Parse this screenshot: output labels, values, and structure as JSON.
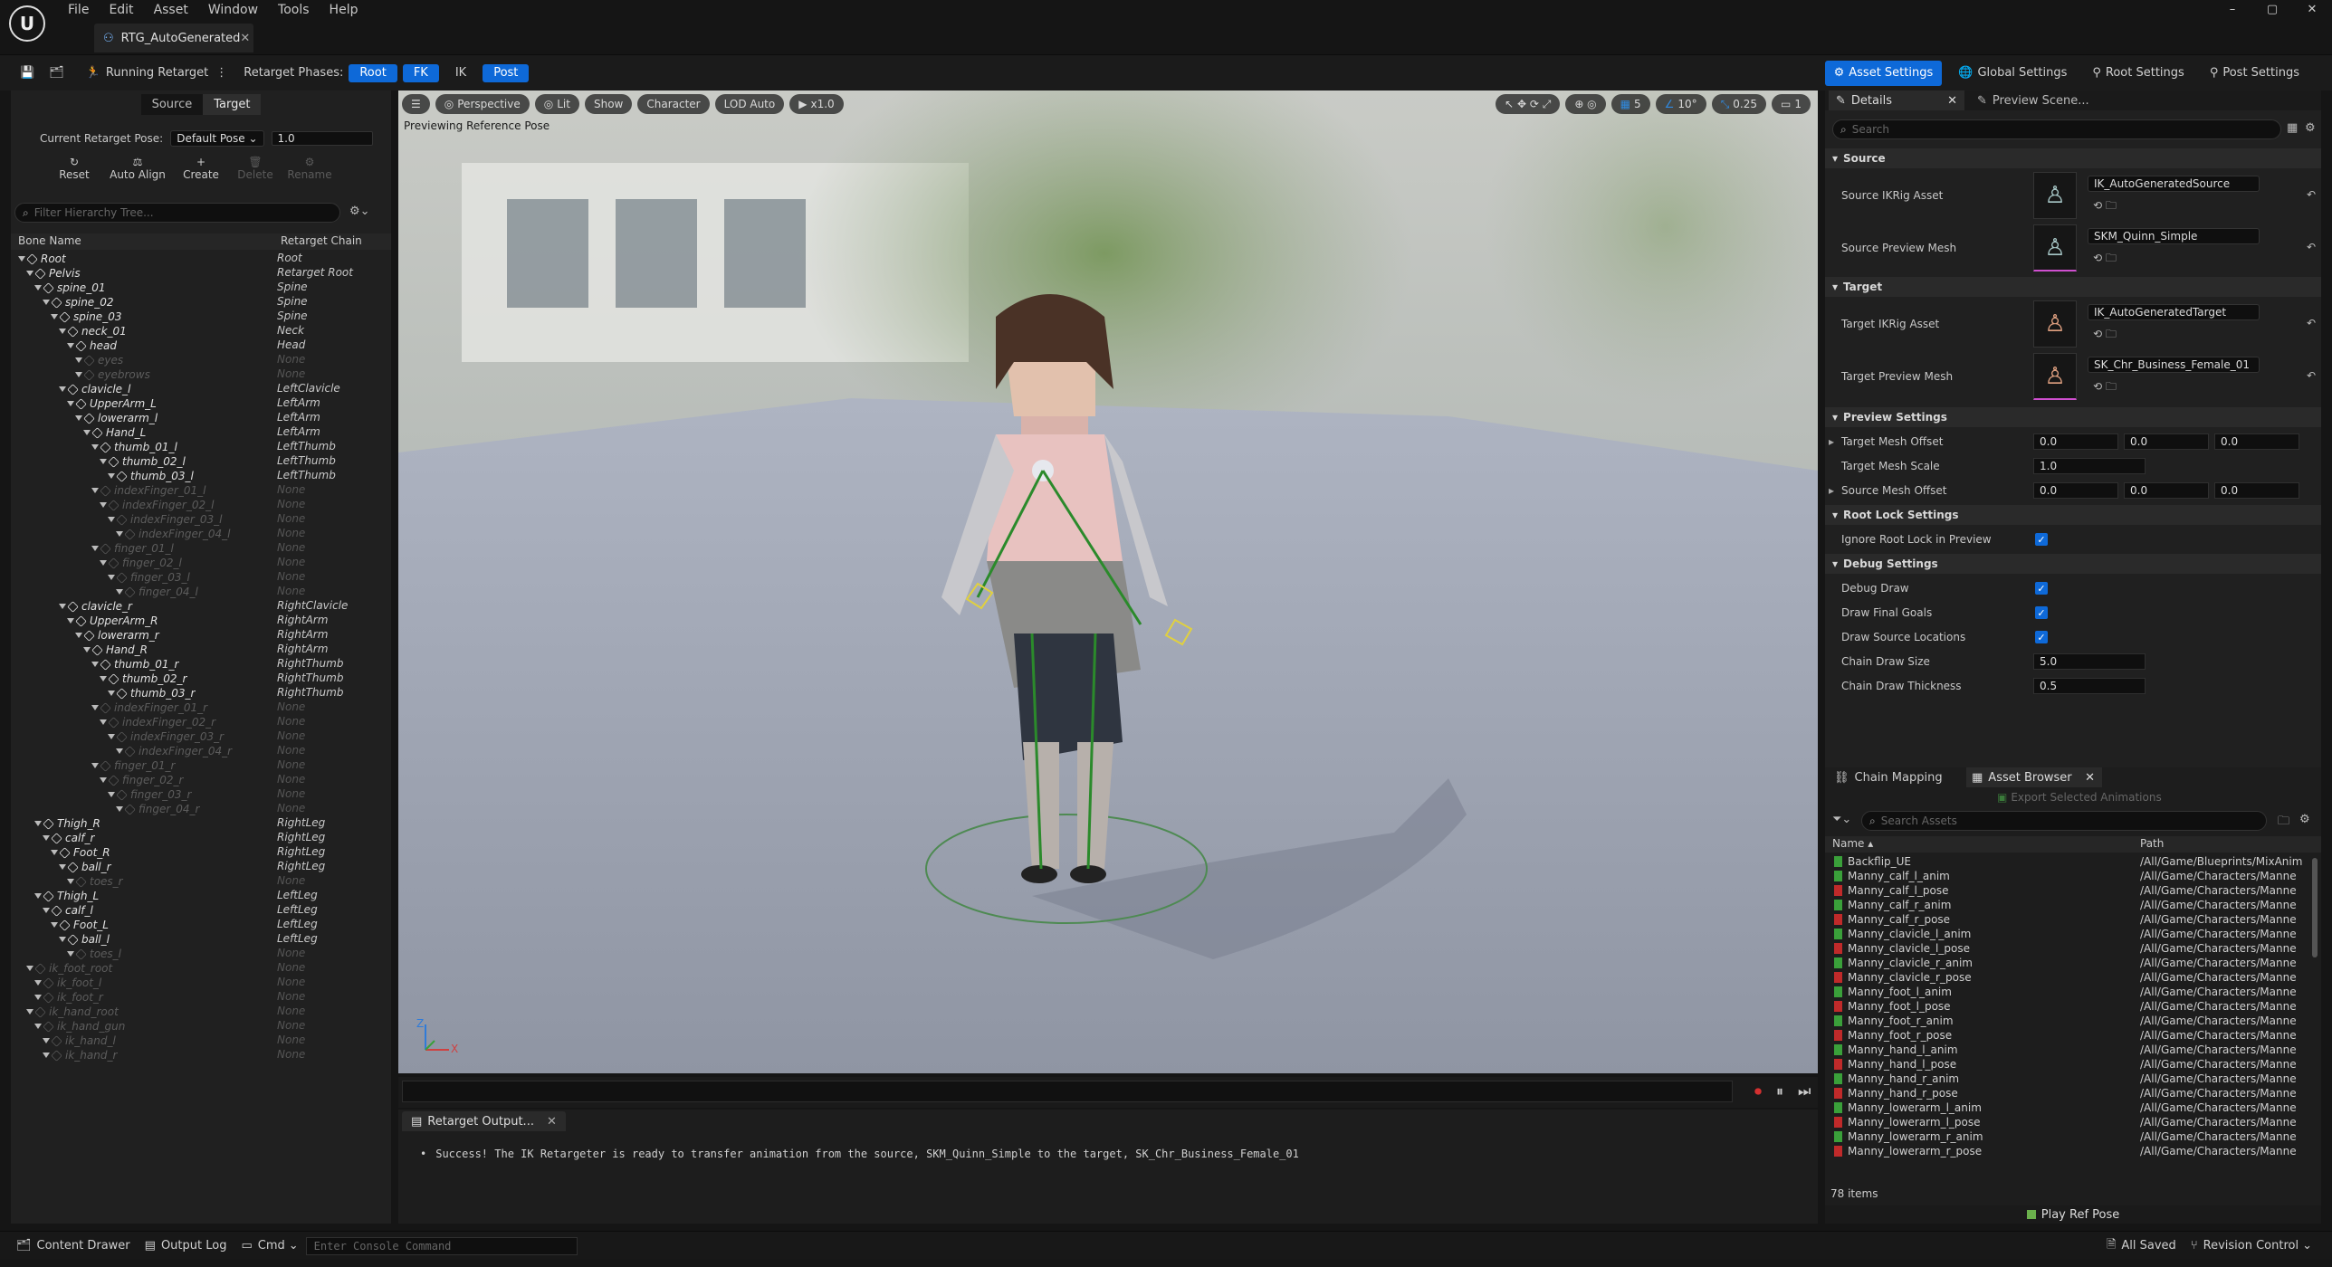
{
  "app": {
    "title": "RTG_AutoGenerated"
  },
  "menu": [
    "File",
    "Edit",
    "Asset",
    "Window",
    "Tools",
    "Help"
  ],
  "window_controls": [
    "–",
    "▢",
    "✕"
  ],
  "toolbar": {
    "running_retarget": "Running Retarget",
    "phases_label": "Retarget Phases:",
    "phases": [
      {
        "label": "Root",
        "on": true
      },
      {
        "label": "FK",
        "on": true
      },
      {
        "label": "IK",
        "on": false
      },
      {
        "label": "Post",
        "on": true
      }
    ],
    "settings_tabs": [
      {
        "label": "Asset Settings",
        "on": true
      },
      {
        "label": "Global Settings",
        "on": false
      },
      {
        "label": "Root Settings",
        "on": false
      },
      {
        "label": "Post Settings",
        "on": false
      }
    ]
  },
  "left": {
    "toggle": {
      "source": "Source",
      "target": "Target"
    },
    "pose_label": "Current Retarget Pose:",
    "pose_value": "Default Pose",
    "pose_blend": "1.0",
    "tools": [
      {
        "label": "Reset",
        "enabled": true
      },
      {
        "label": "Auto Align",
        "enabled": true
      },
      {
        "label": "Create",
        "enabled": true
      },
      {
        "label": "Delete",
        "enabled": false
      },
      {
        "label": "Rename",
        "enabled": false
      }
    ],
    "filter_placeholder": "Filter Hierarchy Tree...",
    "col_bone": "Bone Name",
    "col_chain": "Retarget Chain",
    "bones": [
      {
        "name": "Root",
        "chain": "Root",
        "depth": 0,
        "active": true
      },
      {
        "name": "Pelvis",
        "chain": "Retarget Root",
        "depth": 1,
        "active": true
      },
      {
        "name": "spine_01",
        "chain": "Spine",
        "depth": 2,
        "active": true
      },
      {
        "name": "spine_02",
        "chain": "Spine",
        "depth": 3,
        "active": true
      },
      {
        "name": "spine_03",
        "chain": "Spine",
        "depth": 4,
        "active": true
      },
      {
        "name": "neck_01",
        "chain": "Neck",
        "depth": 5,
        "active": true
      },
      {
        "name": "head",
        "chain": "Head",
        "depth": 6,
        "active": true
      },
      {
        "name": "eyes",
        "chain": "None",
        "depth": 7,
        "active": false
      },
      {
        "name": "eyebrows",
        "chain": "None",
        "depth": 7,
        "active": false
      },
      {
        "name": "clavicle_l",
        "chain": "LeftClavicle",
        "depth": 5,
        "active": true
      },
      {
        "name": "UpperArm_L",
        "chain": "LeftArm",
        "depth": 6,
        "active": true
      },
      {
        "name": "lowerarm_l",
        "chain": "LeftArm",
        "depth": 7,
        "active": true
      },
      {
        "name": "Hand_L",
        "chain": "LeftArm",
        "depth": 8,
        "active": true
      },
      {
        "name": "thumb_01_l",
        "chain": "LeftThumb",
        "depth": 9,
        "active": true
      },
      {
        "name": "thumb_02_l",
        "chain": "LeftThumb",
        "depth": 10,
        "active": true
      },
      {
        "name": "thumb_03_l",
        "chain": "LeftThumb",
        "depth": 11,
        "active": true
      },
      {
        "name": "indexFinger_01_l",
        "chain": "None",
        "depth": 9,
        "active": false
      },
      {
        "name": "indexFinger_02_l",
        "chain": "None",
        "depth": 10,
        "active": false
      },
      {
        "name": "indexFinger_03_l",
        "chain": "None",
        "depth": 11,
        "active": false
      },
      {
        "name": "indexFinger_04_l",
        "chain": "None",
        "depth": 12,
        "active": false
      },
      {
        "name": "finger_01_l",
        "chain": "None",
        "depth": 9,
        "active": false
      },
      {
        "name": "finger_02_l",
        "chain": "None",
        "depth": 10,
        "active": false
      },
      {
        "name": "finger_03_l",
        "chain": "None",
        "depth": 11,
        "active": false
      },
      {
        "name": "finger_04_l",
        "chain": "None",
        "depth": 12,
        "active": false
      },
      {
        "name": "clavicle_r",
        "chain": "RightClavicle",
        "depth": 5,
        "active": true
      },
      {
        "name": "UpperArm_R",
        "chain": "RightArm",
        "depth": 6,
        "active": true
      },
      {
        "name": "lowerarm_r",
        "chain": "RightArm",
        "depth": 7,
        "active": true
      },
      {
        "name": "Hand_R",
        "chain": "RightArm",
        "depth": 8,
        "active": true
      },
      {
        "name": "thumb_01_r",
        "chain": "RightThumb",
        "depth": 9,
        "active": true
      },
      {
        "name": "thumb_02_r",
        "chain": "RightThumb",
        "depth": 10,
        "active": true
      },
      {
        "name": "thumb_03_r",
        "chain": "RightThumb",
        "depth": 11,
        "active": true
      },
      {
        "name": "indexFinger_01_r",
        "chain": "None",
        "depth": 9,
        "active": false
      },
      {
        "name": "indexFinger_02_r",
        "chain": "None",
        "depth": 10,
        "active": false
      },
      {
        "name": "indexFinger_03_r",
        "chain": "None",
        "depth": 11,
        "active": false
      },
      {
        "name": "indexFinger_04_r",
        "chain": "None",
        "depth": 12,
        "active": false
      },
      {
        "name": "finger_01_r",
        "chain": "None",
        "depth": 9,
        "active": false
      },
      {
        "name": "finger_02_r",
        "chain": "None",
        "depth": 10,
        "active": false
      },
      {
        "name": "finger_03_r",
        "chain": "None",
        "depth": 11,
        "active": false
      },
      {
        "name": "finger_04_r",
        "chain": "None",
        "depth": 12,
        "active": false
      },
      {
        "name": "Thigh_R",
        "chain": "RightLeg",
        "depth": 2,
        "active": true
      },
      {
        "name": "calf_r",
        "chain": "RightLeg",
        "depth": 3,
        "active": true
      },
      {
        "name": "Foot_R",
        "chain": "RightLeg",
        "depth": 4,
        "active": true
      },
      {
        "name": "ball_r",
        "chain": "RightLeg",
        "depth": 5,
        "active": true
      },
      {
        "name": "toes_r",
        "chain": "None",
        "depth": 6,
        "active": false
      },
      {
        "name": "Thigh_L",
        "chain": "LeftLeg",
        "depth": 2,
        "active": true
      },
      {
        "name": "calf_l",
        "chain": "LeftLeg",
        "depth": 3,
        "active": true
      },
      {
        "name": "Foot_L",
        "chain": "LeftLeg",
        "depth": 4,
        "active": true
      },
      {
        "name": "ball_l",
        "chain": "LeftLeg",
        "depth": 5,
        "active": true
      },
      {
        "name": "toes_l",
        "chain": "None",
        "depth": 6,
        "active": false
      },
      {
        "name": "ik_foot_root",
        "chain": "None",
        "depth": 1,
        "active": false
      },
      {
        "name": "ik_foot_l",
        "chain": "None",
        "depth": 2,
        "active": false
      },
      {
        "name": "ik_foot_r",
        "chain": "None",
        "depth": 2,
        "active": false
      },
      {
        "name": "ik_hand_root",
        "chain": "None",
        "depth": 1,
        "active": false
      },
      {
        "name": "ik_hand_gun",
        "chain": "None",
        "depth": 2,
        "active": false
      },
      {
        "name": "ik_hand_l",
        "chain": "None",
        "depth": 3,
        "active": false
      },
      {
        "name": "ik_hand_r",
        "chain": "None",
        "depth": 3,
        "active": false
      }
    ]
  },
  "viewport": {
    "buttons": [
      "Perspective",
      "Lit",
      "Show",
      "Character",
      "LOD Auto",
      "x1.0"
    ],
    "right_values": [
      "5",
      "10°",
      "0.25",
      "1"
    ],
    "overlay": "Previewing Reference Pose",
    "axis_z": "Z",
    "axis_x": "X"
  },
  "output": {
    "tab": "Retarget Output...",
    "message": "Success! The IK Retargeter is ready to transfer animation from the source, SKM_Quinn_Simple to the target, SK_Chr_Business_Female_01"
  },
  "details": {
    "tab": "Details",
    "tab2": "Preview Scene...",
    "search_placeholder": "Search",
    "source_section": "Source",
    "source_ikrig_label": "Source IKRig Asset",
    "source_ikrig_value": "IK_AutoGeneratedSource",
    "source_mesh_label": "Source Preview Mesh",
    "source_mesh_value": "SKM_Quinn_Simple",
    "target_section": "Target",
    "target_ikrig_label": "Target IKRig Asset",
    "target_ikrig_value": "IK_AutoGeneratedTarget",
    "target_mesh_label": "Target Preview Mesh",
    "target_mesh_value": "SK_Chr_Business_Female_01",
    "preview_section": "Preview Settings",
    "target_offset_label": "Target Mesh Offset",
    "target_offset": [
      "0.0",
      "0.0",
      "0.0"
    ],
    "target_scale_label": "Target Mesh Scale",
    "target_scale": "1.0",
    "source_offset_label": "Source Mesh Offset",
    "source_offset": [
      "0.0",
      "0.0",
      "0.0"
    ],
    "rootlock_section": "Root Lock Settings",
    "ignore_root_label": "Ignore Root Lock in Preview",
    "debug_section": "Debug Settings",
    "debug_draw_label": "Debug Draw",
    "final_goals_label": "Draw Final Goals",
    "source_locations_label": "Draw Source Locations",
    "chain_size_label": "Chain Draw Size",
    "chain_size": "5.0",
    "chain_thickness_label": "Chain Draw Thickness",
    "chain_thickness": "0.5"
  },
  "browser": {
    "tab1": "Chain Mapping",
    "tab2": "Asset Browser",
    "export_label": "Export Selected Animations",
    "search_placeholder": "Search Assets",
    "col_name": "Name",
    "col_path": "Path",
    "items_count": "78 items",
    "play_ref": "Play Ref Pose",
    "assets": [
      {
        "name": "Backflip_UE",
        "path": "/All/Game/Blueprints/MixAnim",
        "color": "#3aa03a"
      },
      {
        "name": "Manny_calf_l_anim",
        "path": "/All/Game/Characters/Manne",
        "color": "#3aa03a"
      },
      {
        "name": "Manny_calf_l_pose",
        "path": "/All/Game/Characters/Manne",
        "color": "#c02a2a"
      },
      {
        "name": "Manny_calf_r_anim",
        "path": "/All/Game/Characters/Manne",
        "color": "#3aa03a"
      },
      {
        "name": "Manny_calf_r_pose",
        "path": "/All/Game/Characters/Manne",
        "color": "#c02a2a"
      },
      {
        "name": "Manny_clavicle_l_anim",
        "path": "/All/Game/Characters/Manne",
        "color": "#3aa03a"
      },
      {
        "name": "Manny_clavicle_l_pose",
        "path": "/All/Game/Characters/Manne",
        "color": "#c02a2a"
      },
      {
        "name": "Manny_clavicle_r_anim",
        "path": "/All/Game/Characters/Manne",
        "color": "#3aa03a"
      },
      {
        "name": "Manny_clavicle_r_pose",
        "path": "/All/Game/Characters/Manne",
        "color": "#c02a2a"
      },
      {
        "name": "Manny_foot_l_anim",
        "path": "/All/Game/Characters/Manne",
        "color": "#3aa03a"
      },
      {
        "name": "Manny_foot_l_pose",
        "path": "/All/Game/Characters/Manne",
        "color": "#c02a2a"
      },
      {
        "name": "Manny_foot_r_anim",
        "path": "/All/Game/Characters/Manne",
        "color": "#3aa03a"
      },
      {
        "name": "Manny_foot_r_pose",
        "path": "/All/Game/Characters/Manne",
        "color": "#c02a2a"
      },
      {
        "name": "Manny_hand_l_anim",
        "path": "/All/Game/Characters/Manne",
        "color": "#3aa03a"
      },
      {
        "name": "Manny_hand_l_pose",
        "path": "/All/Game/Characters/Manne",
        "color": "#c02a2a"
      },
      {
        "name": "Manny_hand_r_anim",
        "path": "/All/Game/Characters/Manne",
        "color": "#3aa03a"
      },
      {
        "name": "Manny_hand_r_pose",
        "path": "/All/Game/Characters/Manne",
        "color": "#c02a2a"
      },
      {
        "name": "Manny_lowerarm_l_anim",
        "path": "/All/Game/Characters/Manne",
        "color": "#3aa03a"
      },
      {
        "name": "Manny_lowerarm_l_pose",
        "path": "/All/Game/Characters/Manne",
        "color": "#c02a2a"
      },
      {
        "name": "Manny_lowerarm_r_anim",
        "path": "/All/Game/Characters/Manne",
        "color": "#3aa03a"
      },
      {
        "name": "Manny_lowerarm_r_pose",
        "path": "/All/Game/Characters/Manne",
        "color": "#c02a2a"
      }
    ]
  },
  "statusbar": {
    "content_drawer": "Content Drawer",
    "output_log": "Output Log",
    "cmd": "Cmd",
    "console_placeholder": "Enter Console Command",
    "all_saved": "All Saved",
    "revision": "Revision Control"
  }
}
